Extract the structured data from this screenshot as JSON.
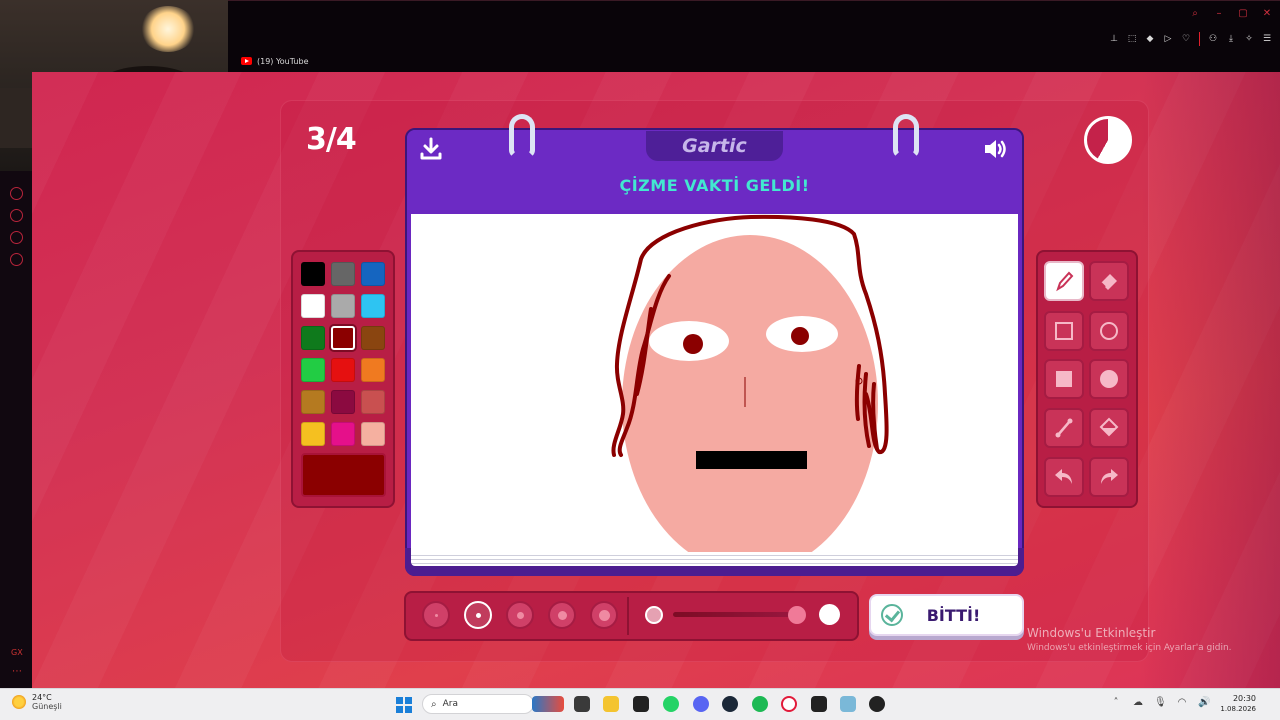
{
  "browser": {
    "tab_title": "(19) YouTube",
    "window_controls": [
      "search-icon",
      "minimize-icon",
      "maximize-icon",
      "close-icon"
    ],
    "toolbar_icons": [
      "pin-icon",
      "screenshot-icon",
      "shield-icon",
      "play-icon",
      "heart-icon",
      "download-icon",
      "send-icon",
      "ai-icon",
      "menu-icon"
    ]
  },
  "game": {
    "round": "3/4",
    "title": "ÇİZME VAKTİ GELDİ!",
    "logo": "Gartic",
    "timer_remaining_fraction": 0.58,
    "palette": {
      "colors": [
        "#000000",
        "#666666",
        "#1565c0",
        "#ffffff",
        "#aaaaaa",
        "#2ec4f2",
        "#0f7a1c",
        "#8b0000",
        "#8a4510",
        "#22cc44",
        "#e51010",
        "#f07a20",
        "#b57a20",
        "#8b0a40",
        "#c95050",
        "#f5c020",
        "#e5108a",
        "#f5b0a0"
      ],
      "selected_index": 7,
      "current_color": "#8b0000"
    },
    "tools": [
      "pencil-icon",
      "eraser-icon",
      "rectangle-outline-icon",
      "circle-outline-icon",
      "rectangle-fill-icon",
      "circle-fill-icon",
      "line-icon",
      "fill-bucket-icon",
      "undo-icon",
      "redo-icon"
    ],
    "active_tool": "pencil-icon",
    "brush_sizes": [
      1,
      2,
      3,
      4,
      5
    ],
    "selected_brush_size_index": 1,
    "opacity_fraction": 0.95,
    "done_label": "BİTTİ!"
  },
  "watermark": {
    "title": "Windows'u Etkinleştir",
    "subtitle": "Windows'u etkinleştirmek için Ayarlar'a gidin."
  },
  "taskbar": {
    "weather_temp": "24°C",
    "weather_desc": "Güneşli",
    "search_placeholder": "Ara",
    "time": "20:30",
    "date": "1.08.2026"
  },
  "colors": {
    "accent": "#d02650",
    "notebook": "#6a27c0",
    "title_text": "#42e8d0"
  }
}
